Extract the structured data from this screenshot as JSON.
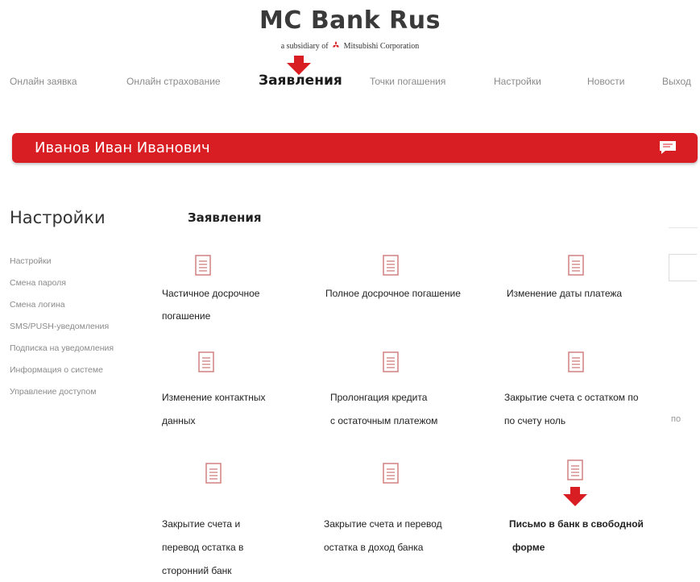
{
  "brand": {
    "title": "MC Bank Rus",
    "subtitle_prefix": "a subsidiary of",
    "subtitle_company": "Mitsubishi Corporation",
    "accent_color": "#d81e23"
  },
  "nav": {
    "items": [
      {
        "label": "Онлайн заявка"
      },
      {
        "label": "Онлайн страхование"
      },
      {
        "label": "Заявления",
        "active": true
      },
      {
        "label": "Точки погашения"
      },
      {
        "label": "Настройки"
      },
      {
        "label": "Новости"
      },
      {
        "label": "Выход"
      }
    ]
  },
  "user": {
    "name": "Иванов Иван Иванович",
    "chat_icon": "chat-bubble-icon"
  },
  "sidebar": {
    "heading": "Настройки",
    "items": [
      {
        "label": "Настройки"
      },
      {
        "label": "Смена пароля"
      },
      {
        "label": "Смена логина"
      },
      {
        "label": "SMS/PUSH-уведомления"
      },
      {
        "label": "Подписка на уведомления"
      },
      {
        "label": "Информация о системе"
      },
      {
        "label": "Управление доступом"
      }
    ]
  },
  "main": {
    "title": "Заявления",
    "right_stub": "по",
    "tiles": [
      {
        "lines": [
          "Частичное досрочное",
          "погашение"
        ]
      },
      {
        "lines": [
          "Полное досрочное погашение"
        ]
      },
      {
        "lines": [
          "Изменение даты платежа"
        ]
      },
      {
        "lines": [
          "Изменение контактных",
          "данных"
        ]
      },
      {
        "lines": [
          "Пролонгация кредита",
          "с остаточным платежом"
        ]
      },
      {
        "lines": [
          "Закрытие счета с остатком по",
          "по счету ноль"
        ]
      },
      {
        "lines": [
          "Закрытие счета и",
          "перевод остатка в",
          "сторонний банк"
        ]
      },
      {
        "lines": [
          "Закрытие счета и перевод",
          "остатка в доход банка"
        ]
      },
      {
        "lines": [
          "Письмо в банк в свободной",
          "форме"
        ],
        "bold": true
      }
    ]
  }
}
